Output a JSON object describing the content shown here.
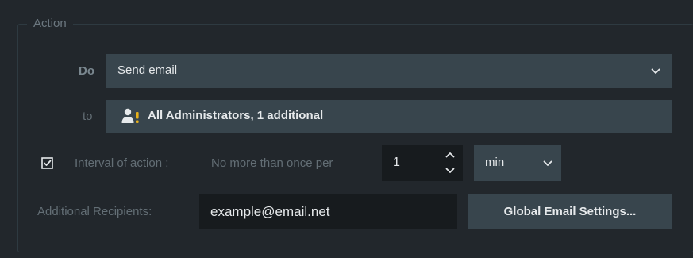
{
  "group": {
    "title": "Action"
  },
  "action": {
    "do_label": "Do",
    "do_value": "Send email",
    "to_label": "to",
    "to_value": "All Administrators, 1 additional"
  },
  "interval": {
    "checked": true,
    "label": "Interval of action :",
    "sub_label": "No more than once per",
    "value": "1",
    "unit": "min"
  },
  "recipients": {
    "label": "Additional Recipients:",
    "value": "example@email.net"
  },
  "buttons": {
    "global_settings": "Global Email Settings..."
  },
  "icons": {
    "user": "user-warning-icon",
    "checkbox": "checkbox-checked-icon",
    "dropdown": "chevron-down-icon",
    "spin_up": "chevron-up-icon",
    "spin_down": "chevron-down-icon"
  },
  "colors": {
    "background": "#22272c",
    "field": "#38454d",
    "input_dark": "#171b1e",
    "label": "#636e75",
    "text": "#e6e9eb",
    "warning": "#e8b11a"
  }
}
